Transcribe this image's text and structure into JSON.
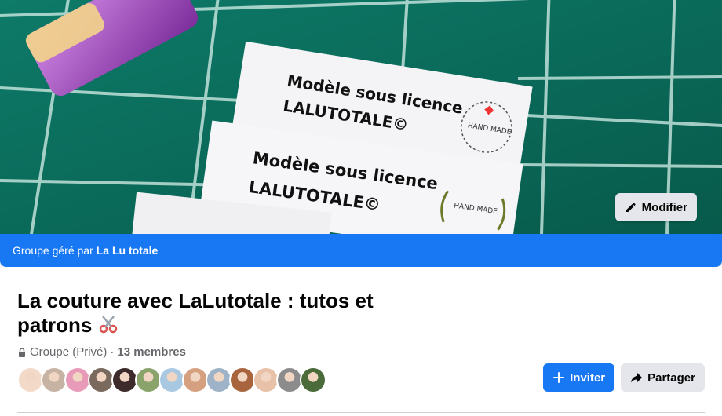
{
  "cover": {
    "label_text_1_line1": "Modèle sous licence",
    "label_text_1_line2": "LALUTOTALE©",
    "label_text_2_line1": "Modèle sous licence",
    "label_text_2_line2": "LALUTOTALE©",
    "stamp_text_1": "HAND MADE",
    "stamp_text_2": "HAND MADE",
    "edit_button": "Modifier"
  },
  "managed": {
    "prefix": "Groupe géré par",
    "admin_name": "La Lu totale"
  },
  "group": {
    "title": "La couture avec LaLutotale : tutos et patrons",
    "privacy": "Groupe (Privé)",
    "separator": "·",
    "members": "13 membres"
  },
  "avatar_colors": [
    "#f3d9c8",
    "#c7b3a4",
    "#e89bb8",
    "#7a6a5d",
    "#3d2b2b",
    "#8aa36a",
    "#a9c9e3",
    "#d5a07f",
    "#9fb3c8",
    "#a8643d",
    "#e7c2a8",
    "#8c8c8c",
    "#4b6b3a"
  ],
  "actions": {
    "invite_label": "Inviter",
    "share_label": "Partager"
  },
  "colors": {
    "brand": "#1877f2",
    "cover_green": "#0a6b5c"
  }
}
